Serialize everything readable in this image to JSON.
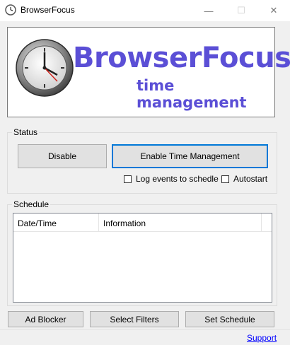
{
  "window": {
    "title": "BrowserFocus",
    "min_glyph": "—",
    "max_glyph": "☐",
    "close_glyph": "✕"
  },
  "banner": {
    "brand_name": "BrowserFocus",
    "tagline": "time management",
    "brand_color": "#5b4fd6"
  },
  "status": {
    "group_label": "Status",
    "disable_label": "Disable",
    "enable_label": "Enable Time Management",
    "log_events_label": "Log events to schedle",
    "log_events_checked": false,
    "autostart_label": "Autostart",
    "autostart_checked": false
  },
  "schedule": {
    "group_label": "Schedule",
    "columns": [
      "Date/Time",
      "Information"
    ],
    "rows": []
  },
  "buttons": {
    "ad_blocker": "Ad Blocker",
    "select_filters": "Select Filters",
    "set_schedule": "Set Schedule"
  },
  "footer": {
    "support_link": "Support"
  }
}
